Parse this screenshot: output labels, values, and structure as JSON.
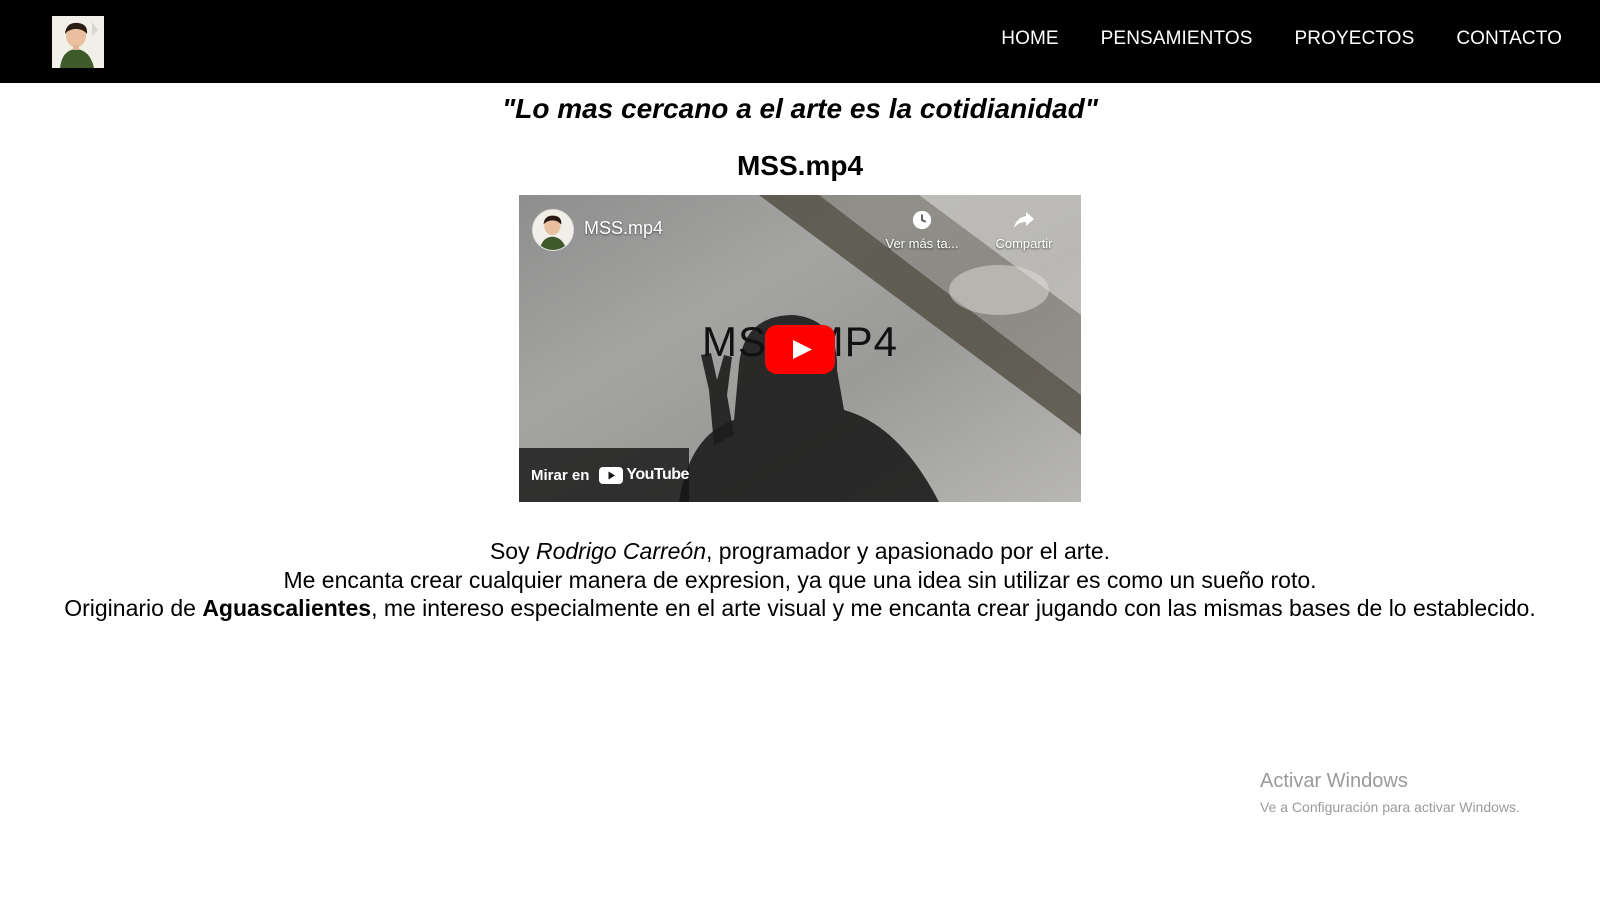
{
  "nav": {
    "logo_icon": "profile-portrait-icon",
    "links": [
      "HOME",
      "PENSAMIENTOS",
      "PROYECTOS",
      "CONTACTO"
    ]
  },
  "quote": "\"Lo mas cercano a el arte es la cotidianidad\"",
  "video_section": {
    "title": "MSS.mp4",
    "player": {
      "channel_icon": "channel-avatar-icon",
      "video_name": "MSS.mp4",
      "watch_later_label": "Ver más ta...",
      "share_label": "Compartir",
      "overlay_text": "MSS.MP4",
      "watch_on_label": "Mirar en",
      "brand_text": "YouTube",
      "play_color": "#ff0000"
    }
  },
  "bio": {
    "line1_prefix": "Soy ",
    "line1_name": "Rodrigo Carreón",
    "line1_suffix": ", programador y apasionado por el arte.",
    "line2": "Me encanta crear cualquier manera de expresion, ya que una idea sin utilizar es como un sueño roto.",
    "line3_prefix": "Originario de ",
    "line3_place": "Aguascalientes",
    "line3_suffix": ", me intereso especialmente en el arte visual y me encanta crear jugando con las mismas bases de lo establecido."
  },
  "watermark": {
    "title": "Activar Windows",
    "subtitle": "Ve a Configuración para activar Windows."
  }
}
